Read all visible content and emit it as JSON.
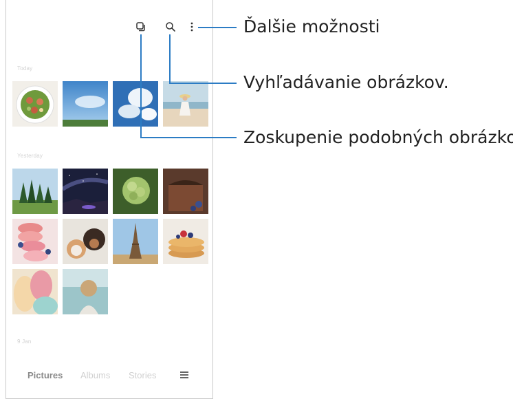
{
  "gallery": {
    "sections": [
      {
        "label": "Today"
      },
      {
        "label": "Yesterday"
      },
      {
        "label": "9 Jan"
      }
    ],
    "thumbnails": [
      {
        "subject": "salad"
      },
      {
        "subject": "sky"
      },
      {
        "subject": "clouds"
      },
      {
        "subject": "girl-on-beach"
      },
      {
        "subject": "forest"
      },
      {
        "subject": "night-sky"
      },
      {
        "subject": "green-flower"
      },
      {
        "subject": "chocolate-cake"
      },
      {
        "subject": "macarons"
      },
      {
        "subject": "pets"
      },
      {
        "subject": "eiffel-tower"
      },
      {
        "subject": "pancakes"
      },
      {
        "subject": "macarons-closeup"
      },
      {
        "subject": "person-at-lake"
      }
    ],
    "bottom_nav": {
      "tabs": [
        {
          "label": "Pictures",
          "active": true
        },
        {
          "label": "Albums",
          "active": false
        },
        {
          "label": "Stories",
          "active": false
        }
      ],
      "menu_icon": "hamburger-icon"
    },
    "toolbar_icons": [
      "group-similar-icon",
      "search-icon",
      "more-options-icon"
    ]
  },
  "callouts": {
    "more_options": "Ďalšie možnosti",
    "search": "Vyhľadávanie obrázkov.",
    "group_similar": "Zoskupenie podobných obrázkov."
  },
  "colors": {
    "callout_line": "#2c7cc4"
  }
}
